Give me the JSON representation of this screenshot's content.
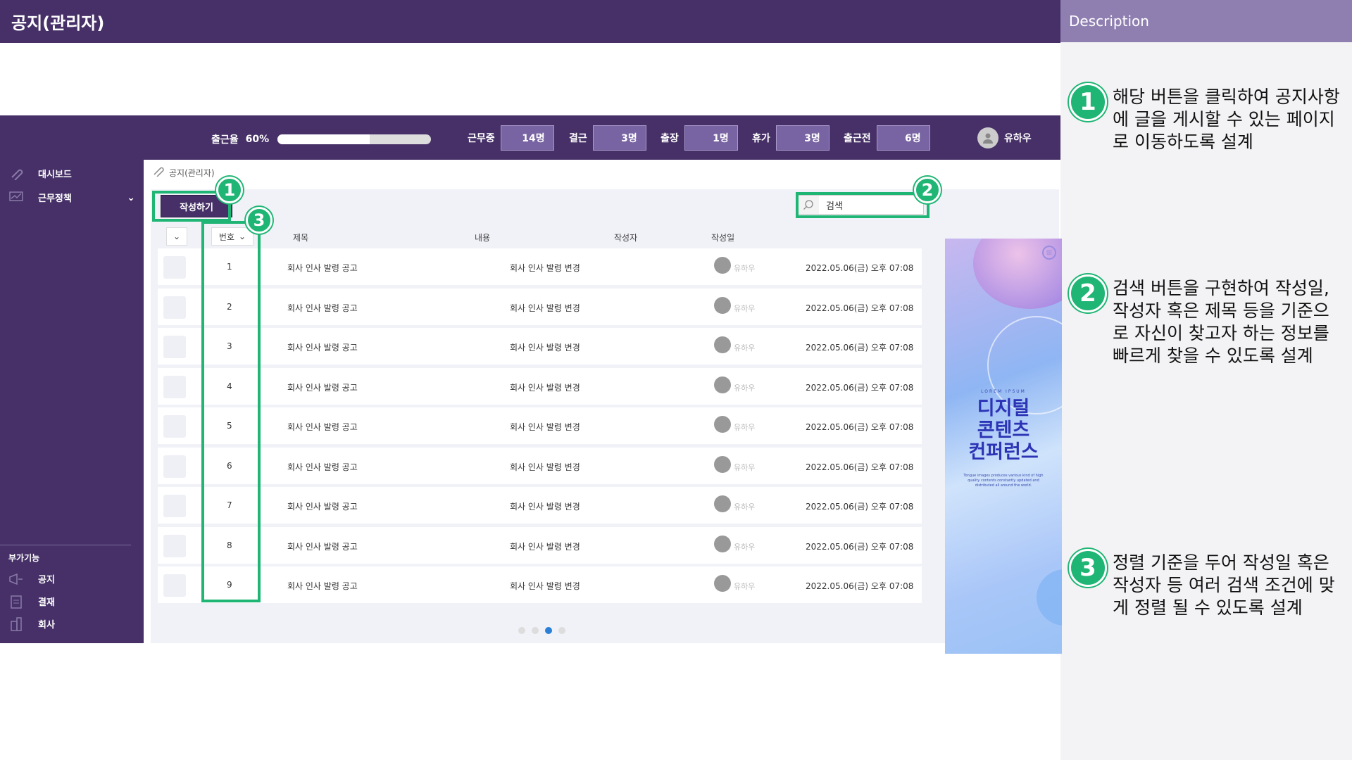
{
  "page_title": "공지(관리자)",
  "description": {
    "header": "Description",
    "items": [
      {
        "num": "1",
        "text": "해당 버튼을 클릭하여 공지사항에 글을 게시할 수 있는 페이지로 이동하도록 설계"
      },
      {
        "num": "2",
        "text": "검색 버튼을 구현하여 작성일, 작성자 혹은 제목 등을 기준으로 자신이 찾고자 하는 정보를 빠르게 찾을 수 있도록 설계"
      },
      {
        "num": "3",
        "text": "정렬 기준을 두어 작성일 혹은 작성자 등 여러 검색 조건에 맞게 정렬 될 수 있도록 설계"
      }
    ]
  },
  "topbar": {
    "rate_label": "출근율",
    "rate_value": "60%",
    "rate_fraction": 0.6,
    "stats": [
      {
        "label": "근무중",
        "value": "14명"
      },
      {
        "label": "결근",
        "value": "3명"
      },
      {
        "label": "출장",
        "value": "1명"
      },
      {
        "label": "휴가",
        "value": "3명"
      },
      {
        "label": "출근전",
        "value": "6명"
      }
    ],
    "user_name": "유하우"
  },
  "sidebar": {
    "items": [
      {
        "label": "대시보드",
        "icon": "clip-icon"
      },
      {
        "label": "근무정책",
        "icon": "chart-icon"
      }
    ],
    "section_label": "부가기능",
    "extra_items": [
      {
        "label": "공지",
        "icon": "megaphone-icon"
      },
      {
        "label": "결재",
        "icon": "clipboard-icon"
      },
      {
        "label": "회사",
        "icon": "building-icon"
      }
    ]
  },
  "breadcrumb": "공지(관리자)",
  "board": {
    "write_button": "작성하기",
    "search_placeholder": "검색",
    "columns": {
      "number": "번호",
      "title": "제목",
      "content": "내용",
      "author": "작성자",
      "date": "작성일"
    },
    "rows": [
      {
        "num": "1",
        "title": "회사 인사 발령 공고",
        "content": "회사 인사 발령 변경",
        "author": "유하우",
        "date": "2022.05.06(금) 오후 07:08"
      },
      {
        "num": "2",
        "title": "회사 인사 발령 공고",
        "content": "회사 인사 발령 변경",
        "author": "유하우",
        "date": "2022.05.06(금) 오후 07:08"
      },
      {
        "num": "3",
        "title": "회사 인사 발령 공고",
        "content": "회사 인사 발령 변경",
        "author": "유하우",
        "date": "2022.05.06(금) 오후 07:08"
      },
      {
        "num": "4",
        "title": "회사 인사 발령 공고",
        "content": "회사 인사 발령 변경",
        "author": "유하우",
        "date": "2022.05.06(금) 오후 07:08"
      },
      {
        "num": "5",
        "title": "회사 인사 발령 공고",
        "content": "회사 인사 발령 변경",
        "author": "유하우",
        "date": "2022.05.06(금) 오후 07:08"
      },
      {
        "num": "6",
        "title": "회사 인사 발령 공고",
        "content": "회사 인사 발령 변경",
        "author": "유하우",
        "date": "2022.05.06(금) 오후 07:08"
      },
      {
        "num": "7",
        "title": "회사 인사 발령 공고",
        "content": "회사 인사 발령 변경",
        "author": "유하우",
        "date": "2022.05.06(금) 오후 07:08"
      },
      {
        "num": "8",
        "title": "회사 인사 발령 공고",
        "content": "회사 인사 발령 변경",
        "author": "유하우",
        "date": "2022.05.06(금) 오후 07:08"
      },
      {
        "num": "9",
        "title": "회사 인사 발령 공고",
        "content": "회사 인사 발령 변경",
        "author": "유하우",
        "date": "2022.05.06(금) 오후 07:08"
      }
    ],
    "pagination_pages": 4,
    "pagination_active": 3
  },
  "banner": {
    "kicker": "LOREM IPSUM",
    "headline": [
      "디지털",
      "콘텐츠",
      "컨퍼런스"
    ],
    "sub": "Tongue images produces various kind of high quality contents constantly updated and distributed all around the world."
  },
  "annotations": [
    "1",
    "2",
    "3"
  ],
  "colors": {
    "brand_purple": "#463067",
    "accent_green": "#1fb574",
    "description_header": "#8f7fb1"
  }
}
